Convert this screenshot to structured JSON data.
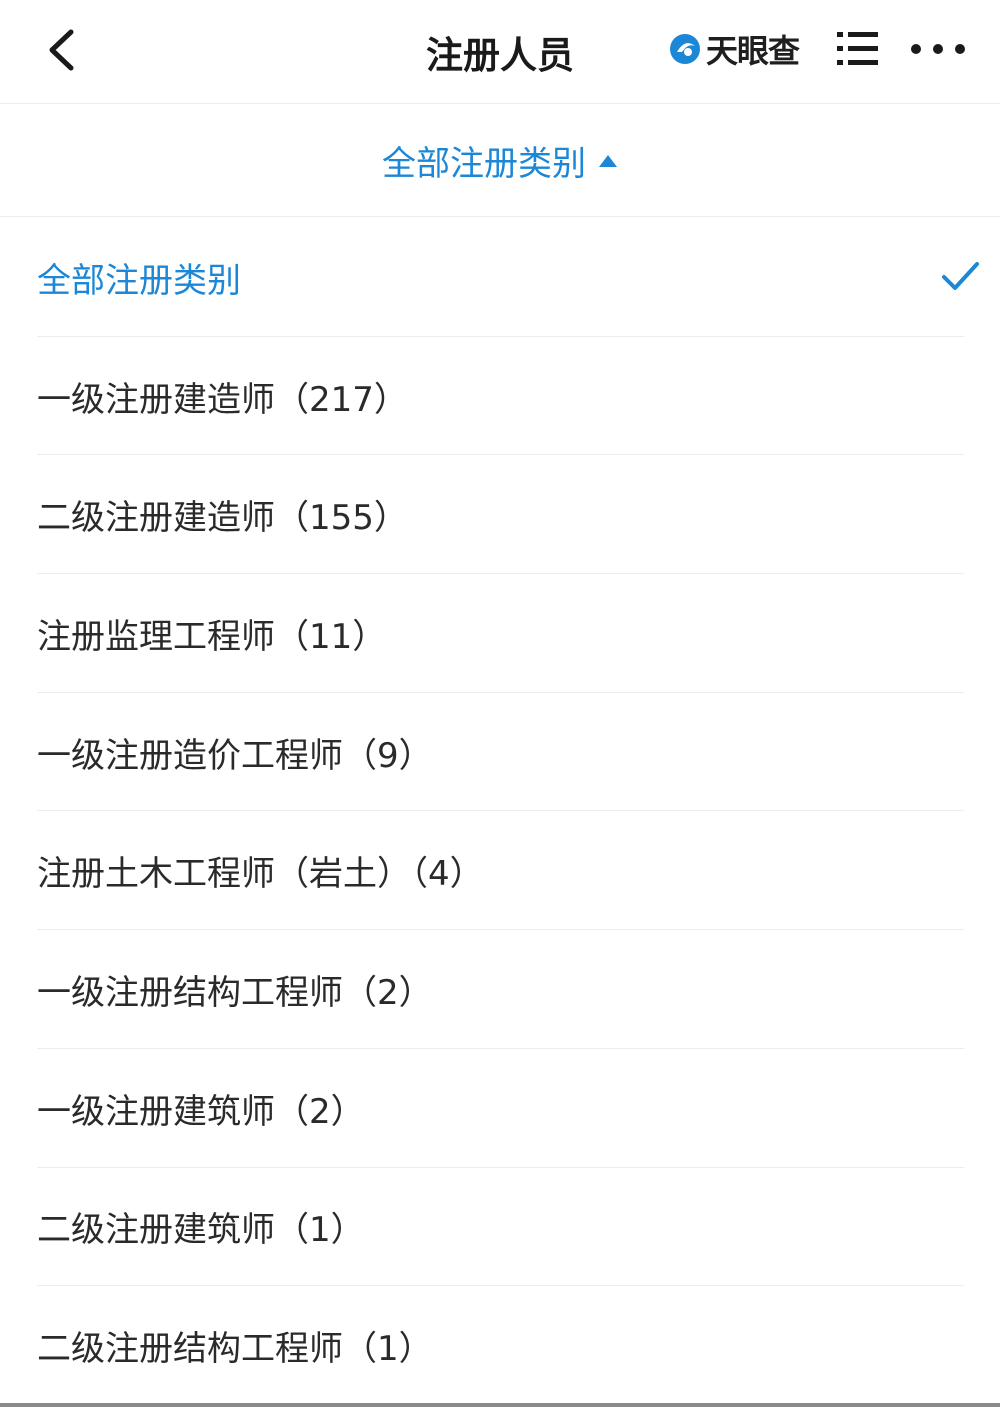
{
  "header": {
    "title": "注册人员",
    "brand_name": "天眼查",
    "icons": {
      "back": "chevron-left-icon",
      "brand_logo": "eye-logo-icon",
      "menu": "list-icon",
      "more": "more-dots-icon"
    }
  },
  "filter": {
    "label": "全部注册类别",
    "caret_icon": "caret-up-icon"
  },
  "colors": {
    "accent": "#1b87d6",
    "text": "#2a2a2a",
    "divider": "#ececec"
  },
  "items": [
    {
      "label": "全部注册类别",
      "selected": true
    },
    {
      "label": "一级注册建造师（217）"
    },
    {
      "label": "二级注册建造师（155）"
    },
    {
      "label": "注册监理工程师（11）"
    },
    {
      "label": "一级注册造价工程师（9）"
    },
    {
      "label": "注册土木工程师（岩土）（4）"
    },
    {
      "label": "一级注册结构工程师（2）"
    },
    {
      "label": "一级注册建筑师（2）"
    },
    {
      "label": "二级注册建筑师（1）"
    },
    {
      "label": "二级注册结构工程师（1）"
    }
  ]
}
